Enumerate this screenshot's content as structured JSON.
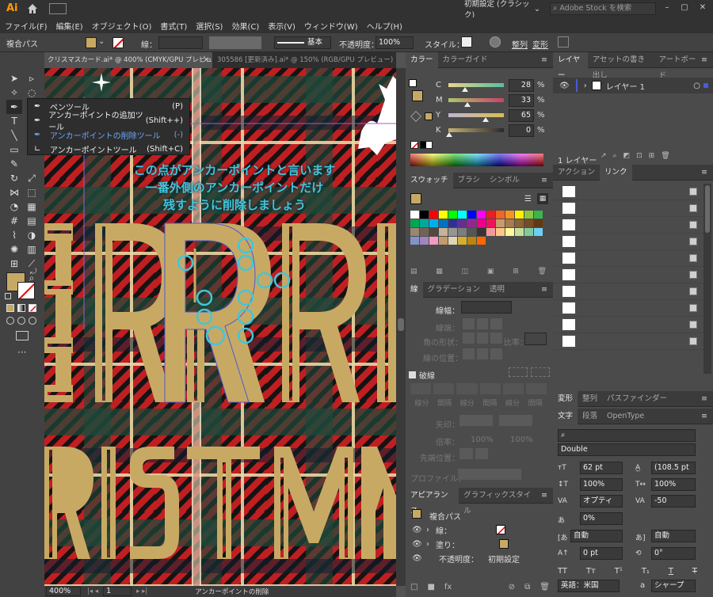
{
  "title_bar": {
    "app_logo": "Ai",
    "workspace": "初期設定 (クラシック)",
    "stock_search_placeholder": "Adobe Stock を検索"
  },
  "menu": [
    "ファイル(F)",
    "編集(E)",
    "オブジェクト(O)",
    "書式(T)",
    "選択(S)",
    "効果(C)",
    "表示(V)",
    "ウィンドウ(W)",
    "ヘルプ(H)"
  ],
  "control": {
    "object_type": "複合パス",
    "stroke_label": "線：",
    "stroke_style": "基本",
    "opacity_label": "不透明度：",
    "opacity_value": "100%",
    "style_label": "スタイル：",
    "align_label": "整列",
    "transform_label": "変形"
  },
  "doc_tabs": [
    {
      "label": "クリスマスカード.ai* @ 400% (CMYK/GPU プレビュー)",
      "active": true
    },
    {
      "label": "305586 [更新済み].ai* @ 150% (RGB/GPU プレビュー)",
      "active": false
    }
  ],
  "flyout": {
    "items": [
      {
        "label": "ペンツール",
        "key": "(P)",
        "active": false
      },
      {
        "label": "アンカーポイントの追加ツール",
        "key": "(Shift++)",
        "active": false
      },
      {
        "label": "アンカーポイントの削除ツール",
        "key": "(-)",
        "active": true
      },
      {
        "label": "アンカーポイントツール",
        "key": "(Shift+C)",
        "active": false
      }
    ]
  },
  "annotation": {
    "line1": "この点がアンカーポイントと言います",
    "line2": "一番外側のアンカーポイントだけ",
    "line3": "残すように削除しましょう"
  },
  "artwork": {
    "row1_text": "ERR",
    "row2_text": "RISTM"
  },
  "status": {
    "zoom": "400%",
    "page": "1",
    "tool_name": "アンカーポイントの削除"
  },
  "color_panel": {
    "tabs": [
      "カラー",
      "カラーガイド"
    ],
    "sliders": [
      {
        "label": "C",
        "value": "28",
        "fraction": 0.28,
        "gradient": "linear-gradient(90deg,#e9d48a,#58bfa0)"
      },
      {
        "label": "M",
        "value": "33",
        "fraction": 0.33,
        "gradient": "linear-gradient(90deg,#b0c46a,#c9406a)"
      },
      {
        "label": "Y",
        "value": "65",
        "fraction": 0.65,
        "gradient": "linear-gradient(90deg,#c0b4d8,#d8c04a)"
      },
      {
        "label": "K",
        "value": "0",
        "fraction": 0.0,
        "gradient": "linear-gradient(90deg,#c8b070,#2a2a2a)"
      }
    ],
    "unit": "%"
  },
  "swatch_panel": {
    "tabs": [
      "スウォッチ",
      "ブラシ",
      "シンボル"
    ],
    "colors": [
      "#ffffff",
      "#000000",
      "#ff0000",
      "#ffff00",
      "#00ff00",
      "#00ffff",
      "#0000ff",
      "#ff00ff",
      "#ed1c24",
      "#f26522",
      "#f7941d",
      "#fff200",
      "#8dc63f",
      "#39b54a",
      "#00a651",
      "#00a99d",
      "#00aeef",
      "#0072bc",
      "#2e3192",
      "#662d91",
      "#92278f",
      "#ec008c",
      "#ed145b",
      "#c69c6d",
      "#a67c52",
      "#8c6239",
      "#754c24",
      "#603913",
      "#998675",
      "#736357",
      "#534741",
      "#c7b299",
      "#959595",
      "#7d7d7d",
      "#555555",
      "#363636",
      "#f5989d",
      "#fdc689",
      "#fff799",
      "#c4df9b",
      "#82ca9c",
      "#6dcff6",
      "#8393ca",
      "#a186be",
      "#f49ac1",
      "#c49a6c",
      "#e2d3b4",
      "#d4af37",
      "#b8860b",
      "#ff6600"
    ]
  },
  "stroke_panel": {
    "tabs": [
      "線",
      "グラデーション",
      "透明"
    ],
    "weight_label": "線幅：",
    "cap_label": "線端：",
    "corner_label": "角の形状：",
    "limit_label": "比率：",
    "align_label": "線の位置："
  },
  "dashed": {
    "label": "破線",
    "dash": "線分",
    "gap": "間隔"
  },
  "arrow": {
    "label": "矢印：",
    "scale_label": "倍率：",
    "scale_1": "100%",
    "scale_2": "100%",
    "tip_label": "先端位置："
  },
  "profile": {
    "label": "プロファイル："
  },
  "appearance": {
    "tabs": [
      "アピアランス",
      "グラフィックスタイル"
    ],
    "title": "複合パス",
    "rows": [
      {
        "label": "線：",
        "swatch": "none"
      },
      {
        "label": "塗り：",
        "swatch": "#c8a964"
      },
      {
        "label": "不透明度：",
        "value": "初期設定"
      }
    ]
  },
  "layers_panel": {
    "tabs": [
      "レイヤー",
      "アセットの書き出し",
      "アートボード"
    ],
    "layer_name": "レイヤー 1",
    "count": "1 レイヤー"
  },
  "links_panel": {
    "tabs": [
      "アクション",
      "リンク"
    ],
    "count": 10
  },
  "char_panel": {
    "tabs1": [
      "変形",
      "整列",
      "パスファインダー"
    ],
    "tabs2": [
      "文字",
      "段落",
      "OpenType"
    ],
    "search_placeholder": "",
    "font_style": "Double",
    "size": "62 pt",
    "leading": "(108.5 pt",
    "hscale": "100%",
    "vscale": "100%",
    "kerning": "オプティ",
    "tracking": "-50",
    "tsume": "0%",
    "aki1": "自動",
    "aki2": "自動",
    "baseline": "0 pt",
    "rotation": "0°",
    "language": "英語：米国",
    "aa": "a",
    "aa_mode": "シャープ"
  },
  "colors": {
    "fill": "#c8a964",
    "accent": "#42c6da",
    "canvas_red": "#b22222",
    "path_blue": "#4a5bd4"
  }
}
